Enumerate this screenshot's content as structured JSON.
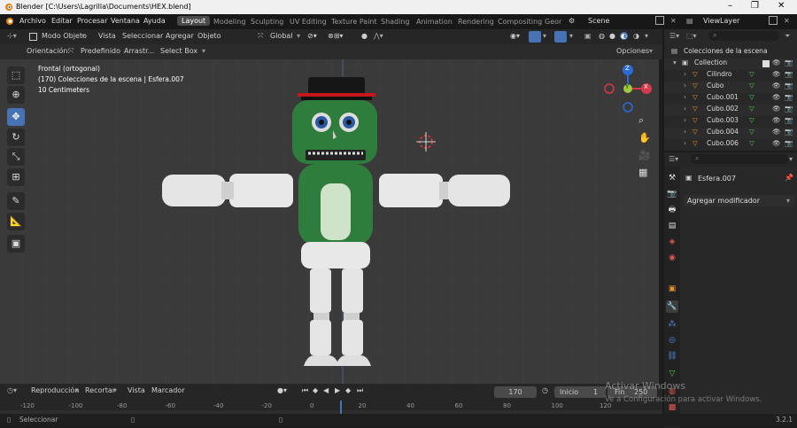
{
  "title_bar": {
    "text": "Blender [C:\\Users\\Lagrilla\\Documents\\HEX.blend]",
    "minimize": "–",
    "maximize": "❐",
    "close": "✕"
  },
  "menu": {
    "items": [
      "Archivo",
      "Editar",
      "Procesar",
      "Ventana",
      "Ayuda"
    ],
    "workspaces": [
      "Layout",
      "Modeling",
      "Sculpting",
      "UV Editing",
      "Texture Paint",
      "Shading",
      "Animation",
      "Rendering",
      "Compositing",
      "Geor"
    ],
    "scene": "Scene",
    "view_layer": "ViewLayer"
  },
  "viewport_header": {
    "mode": "Modo Objeto",
    "view": "Vista",
    "select": "Seleccionar",
    "add": "Agregar",
    "object": "Objeto",
    "transform": "Global"
  },
  "tool_settings": {
    "orientation_label": "Orientación:",
    "orientation_value": "Predefinido",
    "drag_label": "Arrastr...",
    "drag_value": "Select Box",
    "options": "Opciones"
  },
  "viewport_info": {
    "view_name": "Frontal (ortogonal)",
    "collection_line": "(170) Colecciones de la escena | Esfera.007",
    "scale": "10 Centimeters"
  },
  "gizmo": {
    "x": "X",
    "y": "Y",
    "z": "Z"
  },
  "outliner": {
    "root": "Colecciones de la escena",
    "collection": "Collection",
    "items": [
      "Cilindro",
      "Cubo",
      "Cubo.001",
      "Cubo.002",
      "Cubo.003",
      "Cubo.004",
      "Cubo.006"
    ]
  },
  "properties": {
    "object_name": "Esfera.007",
    "add_modifier": "Agregar modificador"
  },
  "timeline": {
    "playback": "Reproducción",
    "keying": "Recortar",
    "view": "Vista",
    "markers": "Marcador",
    "current_frame": "170",
    "start_label": "Inicio",
    "start": "1",
    "end_label": "Fin",
    "end": "250",
    "ruler": [
      "-120",
      "-100",
      "-80",
      "-60",
      "-40",
      "-20",
      "0",
      "20",
      "40",
      "60",
      "80",
      "100",
      "120"
    ]
  },
  "status": {
    "select": "Seleccionar",
    "version": "3.2.1"
  },
  "watermark": {
    "line1": "Activar Windows",
    "line2": "Ve a Configuración para activar Windows."
  },
  "colors": {
    "accent": "#4772b3",
    "robot_green": "#2f7d3c",
    "hat": "#1a1a1a",
    "hat_band": "#c8161d"
  }
}
